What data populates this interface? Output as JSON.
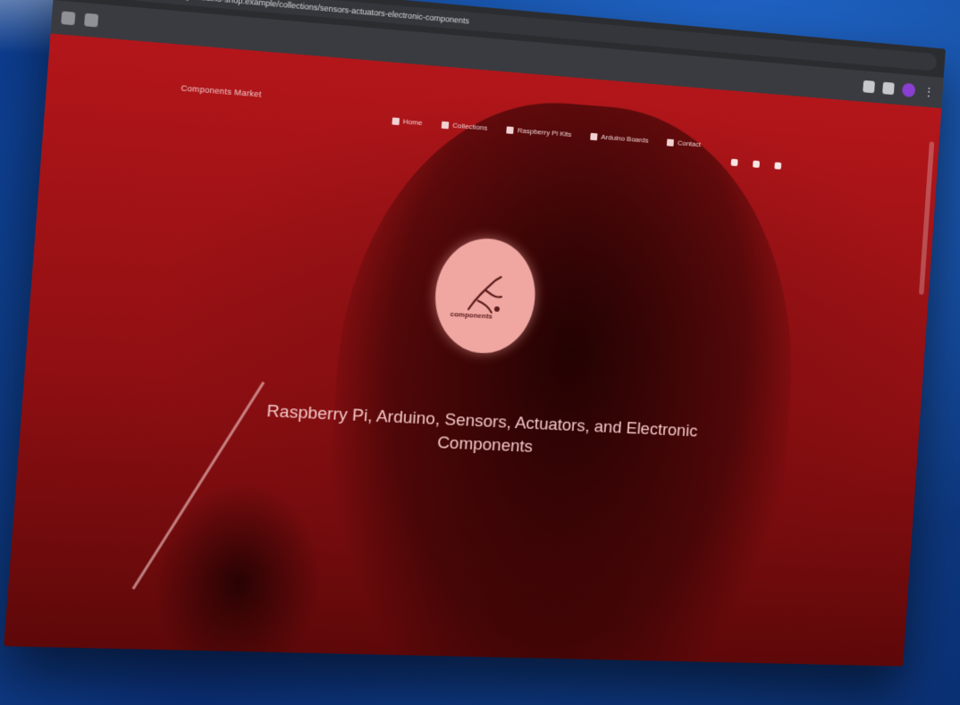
{
  "browser": {
    "url": "raspberry-arduino-shop.example/collections/sensors-actuators-electronic-components"
  },
  "site": {
    "brand": "Components Market",
    "nav": [
      {
        "label": "Home"
      },
      {
        "label": "Collections"
      },
      {
        "label": "Raspberry Pi Kits"
      },
      {
        "label": "Arduino Boards"
      },
      {
        "label": "Contact"
      }
    ],
    "hero": {
      "logo_text": "components",
      "tagline": "Raspberry Pi, Arduino, Sensors, Actuators, and Electronic Components"
    }
  },
  "icons": {
    "lock": "lock-icon",
    "extension": "puzzle-icon",
    "profile": "profile-icon",
    "social": [
      "facebook-icon",
      "instagram-icon",
      "youtube-icon"
    ]
  },
  "colors": {
    "page_background": "#b3161a",
    "logo_fill": "#f0a7a2",
    "desktop_background": "#0d3b8f",
    "browser_chrome": "#2b2c30"
  }
}
